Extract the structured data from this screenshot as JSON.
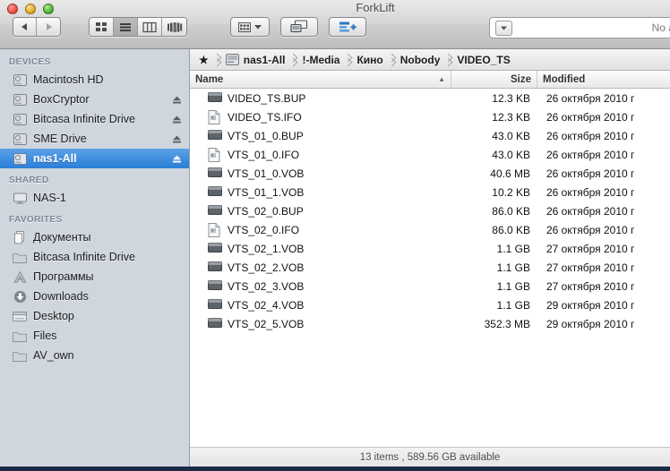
{
  "window": {
    "title": "ForkLift",
    "traffic_lights": [
      "close",
      "minimize",
      "zoom"
    ]
  },
  "toolbar": {
    "back_label": "◀",
    "forward_label": "▶",
    "view_modes": [
      {
        "name": "icon-view",
        "selected": false
      },
      {
        "name": "list-view",
        "selected": true
      },
      {
        "name": "column-view",
        "selected": false
      },
      {
        "name": "coverflow-view",
        "selected": false
      }
    ],
    "action_button": "action-menu",
    "remote_button": "remote-connect",
    "newtab_button": "new-tab",
    "transfer_field": {
      "popup": "▾",
      "status_text": "No ac"
    }
  },
  "sidebar": {
    "groups": [
      {
        "header": "DEVICES",
        "items": [
          {
            "label": "Macintosh HD",
            "icon": "hard-drive-icon",
            "eject": false,
            "selected": false
          },
          {
            "label": "BoxCryptor",
            "icon": "hard-drive-icon",
            "eject": true,
            "selected": false
          },
          {
            "label": "Bitcasa Infinite Drive",
            "icon": "hard-drive-icon",
            "eject": true,
            "selected": false
          },
          {
            "label": "SME Drive",
            "icon": "hard-drive-icon",
            "eject": true,
            "selected": false
          },
          {
            "label": "nas1-All",
            "icon": "hard-drive-icon",
            "eject": true,
            "selected": true
          }
        ]
      },
      {
        "header": "SHARED",
        "items": [
          {
            "label": "NAS-1",
            "icon": "display-icon",
            "eject": false,
            "selected": false
          }
        ]
      },
      {
        "header": "FAVORITES",
        "items": [
          {
            "label": "Документы",
            "icon": "documents-icon",
            "eject": false,
            "selected": false
          },
          {
            "label": "Bitcasa Infinite Drive",
            "icon": "folder-icon",
            "eject": false,
            "selected": false
          },
          {
            "label": "Программы",
            "icon": "applications-icon",
            "eject": false,
            "selected": false
          },
          {
            "label": "Downloads",
            "icon": "downloads-icon",
            "eject": false,
            "selected": false
          },
          {
            "label": "Desktop",
            "icon": "desktop-icon",
            "eject": false,
            "selected": false
          },
          {
            "label": "Files",
            "icon": "folder-icon",
            "eject": false,
            "selected": false
          },
          {
            "label": "AV_own",
            "icon": "folder-icon",
            "eject": false,
            "selected": false
          }
        ]
      }
    ]
  },
  "breadcrumb": {
    "star": "★",
    "items": [
      "nas1-All",
      "!-Media",
      "Кино",
      "Nobody",
      "VIDEO_TS"
    ]
  },
  "columns": {
    "name": "Name",
    "size": "Size",
    "modified": "Modified",
    "sort_arrow": "▲",
    "sort_column": "name",
    "sort_direction": "ascending"
  },
  "files": [
    {
      "name": "VIDEO_TS.BUP",
      "icon": "binary-file-icon",
      "size": "12.3 KB",
      "modified": "26 октября 2010 г"
    },
    {
      "name": "VIDEO_TS.IFO",
      "icon": "document-file-icon",
      "size": "12.3 KB",
      "modified": "26 октября 2010 г"
    },
    {
      "name": "VTS_01_0.BUP",
      "icon": "binary-file-icon",
      "size": "43.0 KB",
      "modified": "26 октября 2010 г"
    },
    {
      "name": "VTS_01_0.IFO",
      "icon": "document-file-icon",
      "size": "43.0 KB",
      "modified": "26 октября 2010 г"
    },
    {
      "name": "VTS_01_0.VOB",
      "icon": "binary-file-icon",
      "size": "40.6 MB",
      "modified": "26 октября 2010 г"
    },
    {
      "name": "VTS_01_1.VOB",
      "icon": "binary-file-icon",
      "size": "10.2 KB",
      "modified": "26 октября 2010 г"
    },
    {
      "name": "VTS_02_0.BUP",
      "icon": "binary-file-icon",
      "size": "86.0 KB",
      "modified": "26 октября 2010 г"
    },
    {
      "name": "VTS_02_0.IFO",
      "icon": "document-file-icon",
      "size": "86.0 KB",
      "modified": "26 октября 2010 г"
    },
    {
      "name": "VTS_02_1.VOB",
      "icon": "binary-file-icon",
      "size": "1.1 GB",
      "modified": "27 октября 2010 г"
    },
    {
      "name": "VTS_02_2.VOB",
      "icon": "binary-file-icon",
      "size": "1.1 GB",
      "modified": "27 октября 2010 г"
    },
    {
      "name": "VTS_02_3.VOB",
      "icon": "binary-file-icon",
      "size": "1.1 GB",
      "modified": "27 октября 2010 г"
    },
    {
      "name": "VTS_02_4.VOB",
      "icon": "binary-file-icon",
      "size": "1.1 GB",
      "modified": "29 октября 2010 г"
    },
    {
      "name": "VTS_02_5.VOB",
      "icon": "binary-file-icon",
      "size": "352.3 MB",
      "modified": "29 октября 2010 г"
    }
  ],
  "statusbar": {
    "text": "13 items , 589.56 GB available"
  },
  "colors": {
    "selection_blue": "#2b7fd6",
    "sidebar_bg": "#cfd6de",
    "accent_icon_blue": "#2b72c6"
  }
}
